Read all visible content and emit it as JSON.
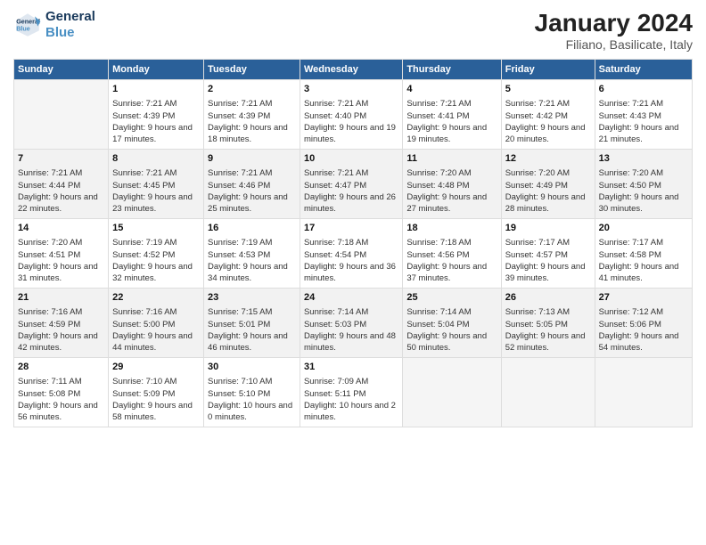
{
  "header": {
    "logo_general": "General",
    "logo_blue": "Blue",
    "month_title": "January 2024",
    "location": "Filiano, Basilicate, Italy"
  },
  "days_of_week": [
    "Sunday",
    "Monday",
    "Tuesday",
    "Wednesday",
    "Thursday",
    "Friday",
    "Saturday"
  ],
  "weeks": [
    {
      "band": "odd",
      "days": [
        {
          "num": "",
          "empty": true
        },
        {
          "num": "1",
          "sunrise": "Sunrise: 7:21 AM",
          "sunset": "Sunset: 4:39 PM",
          "daylight": "Daylight: 9 hours and 17 minutes."
        },
        {
          "num": "2",
          "sunrise": "Sunrise: 7:21 AM",
          "sunset": "Sunset: 4:39 PM",
          "daylight": "Daylight: 9 hours and 18 minutes."
        },
        {
          "num": "3",
          "sunrise": "Sunrise: 7:21 AM",
          "sunset": "Sunset: 4:40 PM",
          "daylight": "Daylight: 9 hours and 19 minutes."
        },
        {
          "num": "4",
          "sunrise": "Sunrise: 7:21 AM",
          "sunset": "Sunset: 4:41 PM",
          "daylight": "Daylight: 9 hours and 19 minutes."
        },
        {
          "num": "5",
          "sunrise": "Sunrise: 7:21 AM",
          "sunset": "Sunset: 4:42 PM",
          "daylight": "Daylight: 9 hours and 20 minutes."
        },
        {
          "num": "6",
          "sunrise": "Sunrise: 7:21 AM",
          "sunset": "Sunset: 4:43 PM",
          "daylight": "Daylight: 9 hours and 21 minutes."
        }
      ]
    },
    {
      "band": "even",
      "days": [
        {
          "num": "7",
          "sunrise": "Sunrise: 7:21 AM",
          "sunset": "Sunset: 4:44 PM",
          "daylight": "Daylight: 9 hours and 22 minutes."
        },
        {
          "num": "8",
          "sunrise": "Sunrise: 7:21 AM",
          "sunset": "Sunset: 4:45 PM",
          "daylight": "Daylight: 9 hours and 23 minutes."
        },
        {
          "num": "9",
          "sunrise": "Sunrise: 7:21 AM",
          "sunset": "Sunset: 4:46 PM",
          "daylight": "Daylight: 9 hours and 25 minutes."
        },
        {
          "num": "10",
          "sunrise": "Sunrise: 7:21 AM",
          "sunset": "Sunset: 4:47 PM",
          "daylight": "Daylight: 9 hours and 26 minutes."
        },
        {
          "num": "11",
          "sunrise": "Sunrise: 7:20 AM",
          "sunset": "Sunset: 4:48 PM",
          "daylight": "Daylight: 9 hours and 27 minutes."
        },
        {
          "num": "12",
          "sunrise": "Sunrise: 7:20 AM",
          "sunset": "Sunset: 4:49 PM",
          "daylight": "Daylight: 9 hours and 28 minutes."
        },
        {
          "num": "13",
          "sunrise": "Sunrise: 7:20 AM",
          "sunset": "Sunset: 4:50 PM",
          "daylight": "Daylight: 9 hours and 30 minutes."
        }
      ]
    },
    {
      "band": "odd",
      "days": [
        {
          "num": "14",
          "sunrise": "Sunrise: 7:20 AM",
          "sunset": "Sunset: 4:51 PM",
          "daylight": "Daylight: 9 hours and 31 minutes."
        },
        {
          "num": "15",
          "sunrise": "Sunrise: 7:19 AM",
          "sunset": "Sunset: 4:52 PM",
          "daylight": "Daylight: 9 hours and 32 minutes."
        },
        {
          "num": "16",
          "sunrise": "Sunrise: 7:19 AM",
          "sunset": "Sunset: 4:53 PM",
          "daylight": "Daylight: 9 hours and 34 minutes."
        },
        {
          "num": "17",
          "sunrise": "Sunrise: 7:18 AM",
          "sunset": "Sunset: 4:54 PM",
          "daylight": "Daylight: 9 hours and 36 minutes."
        },
        {
          "num": "18",
          "sunrise": "Sunrise: 7:18 AM",
          "sunset": "Sunset: 4:56 PM",
          "daylight": "Daylight: 9 hours and 37 minutes."
        },
        {
          "num": "19",
          "sunrise": "Sunrise: 7:17 AM",
          "sunset": "Sunset: 4:57 PM",
          "daylight": "Daylight: 9 hours and 39 minutes."
        },
        {
          "num": "20",
          "sunrise": "Sunrise: 7:17 AM",
          "sunset": "Sunset: 4:58 PM",
          "daylight": "Daylight: 9 hours and 41 minutes."
        }
      ]
    },
    {
      "band": "even",
      "days": [
        {
          "num": "21",
          "sunrise": "Sunrise: 7:16 AM",
          "sunset": "Sunset: 4:59 PM",
          "daylight": "Daylight: 9 hours and 42 minutes."
        },
        {
          "num": "22",
          "sunrise": "Sunrise: 7:16 AM",
          "sunset": "Sunset: 5:00 PM",
          "daylight": "Daylight: 9 hours and 44 minutes."
        },
        {
          "num": "23",
          "sunrise": "Sunrise: 7:15 AM",
          "sunset": "Sunset: 5:01 PM",
          "daylight": "Daylight: 9 hours and 46 minutes."
        },
        {
          "num": "24",
          "sunrise": "Sunrise: 7:14 AM",
          "sunset": "Sunset: 5:03 PM",
          "daylight": "Daylight: 9 hours and 48 minutes."
        },
        {
          "num": "25",
          "sunrise": "Sunrise: 7:14 AM",
          "sunset": "Sunset: 5:04 PM",
          "daylight": "Daylight: 9 hours and 50 minutes."
        },
        {
          "num": "26",
          "sunrise": "Sunrise: 7:13 AM",
          "sunset": "Sunset: 5:05 PM",
          "daylight": "Daylight: 9 hours and 52 minutes."
        },
        {
          "num": "27",
          "sunrise": "Sunrise: 7:12 AM",
          "sunset": "Sunset: 5:06 PM",
          "daylight": "Daylight: 9 hours and 54 minutes."
        }
      ]
    },
    {
      "band": "odd",
      "days": [
        {
          "num": "28",
          "sunrise": "Sunrise: 7:11 AM",
          "sunset": "Sunset: 5:08 PM",
          "daylight": "Daylight: 9 hours and 56 minutes."
        },
        {
          "num": "29",
          "sunrise": "Sunrise: 7:10 AM",
          "sunset": "Sunset: 5:09 PM",
          "daylight": "Daylight: 9 hours and 58 minutes."
        },
        {
          "num": "30",
          "sunrise": "Sunrise: 7:10 AM",
          "sunset": "Sunset: 5:10 PM",
          "daylight": "Daylight: 10 hours and 0 minutes."
        },
        {
          "num": "31",
          "sunrise": "Sunrise: 7:09 AM",
          "sunset": "Sunset: 5:11 PM",
          "daylight": "Daylight: 10 hours and 2 minutes."
        },
        {
          "num": "",
          "empty": true
        },
        {
          "num": "",
          "empty": true
        },
        {
          "num": "",
          "empty": true
        }
      ]
    }
  ]
}
